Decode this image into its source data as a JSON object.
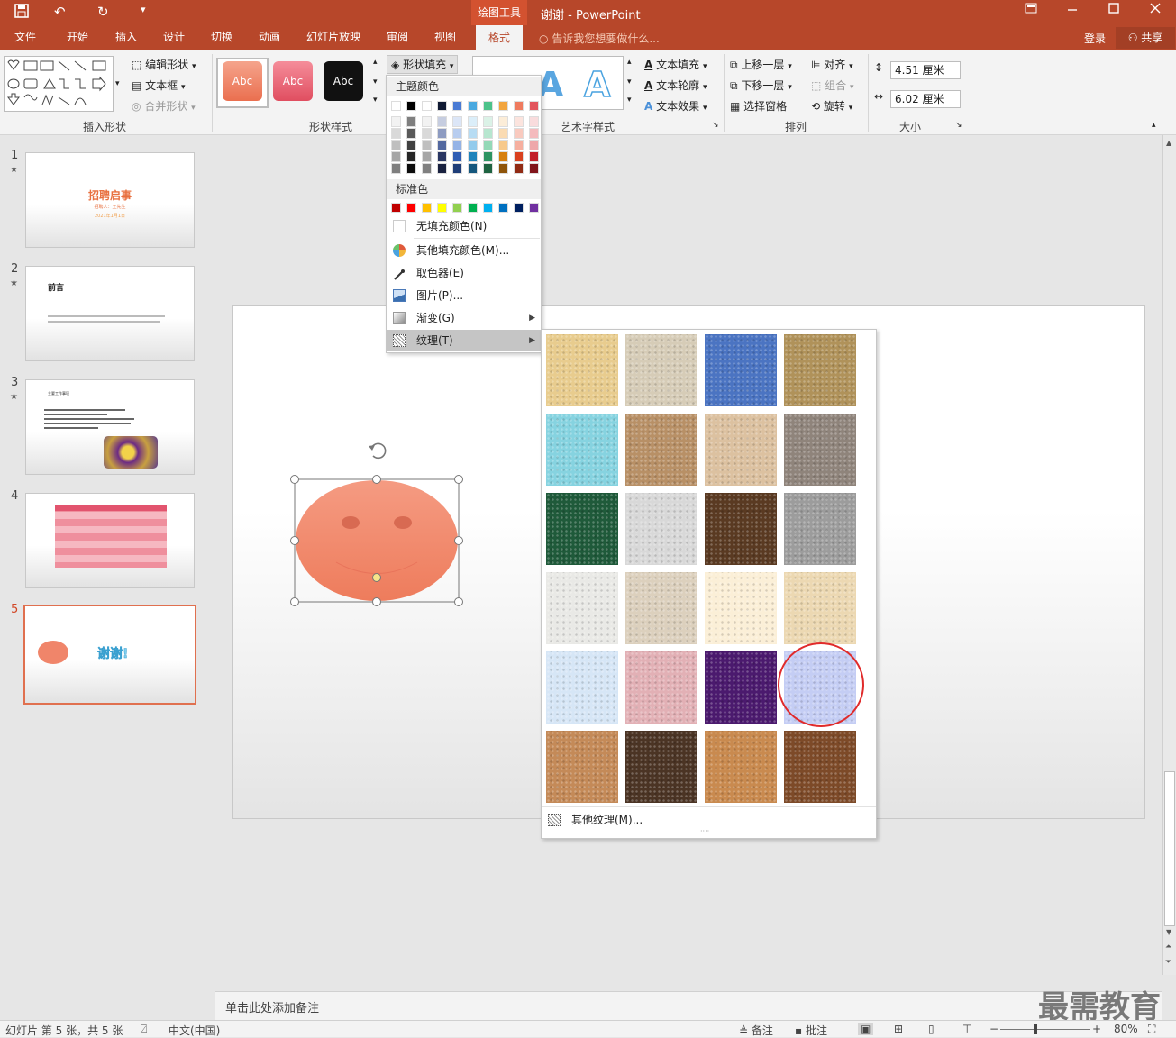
{
  "titlebar": {
    "tool_tab": "绘图工具",
    "title": "谢谢 - PowerPoint",
    "qat_undo": "↶",
    "qat_redo": "↻",
    "more": "▾"
  },
  "tabs": [
    "文件",
    "开始",
    "插入",
    "设计",
    "切换",
    "动画",
    "幻灯片放映",
    "审阅",
    "视图"
  ],
  "active_tab": "格式",
  "tell_me": "告诉我您想要做什么...",
  "login": "登录",
  "share": "共享",
  "ribbon": {
    "edit_shape": "编辑形状",
    "text_box": "文本框",
    "merge_shapes": "合并形状",
    "insert_shapes_label": "插入形状",
    "style_abc": [
      "Abc",
      "Abc",
      "Abc"
    ],
    "shape_styles_label": "形状样式",
    "shape_fill": "形状填充",
    "text_fill": "文本填充",
    "text_outline": "文本轮廓",
    "text_effects": "文本效果",
    "wordart_label": "艺术字样式",
    "bring_forward": "上移一层",
    "send_backward": "下移一层",
    "selection_pane": "选择窗格",
    "align": "对齐",
    "group": "组合",
    "rotate": "旋转",
    "arrange_label": "排列",
    "height": "4.51 厘米",
    "width": "6.02 厘米",
    "size_label": "大小"
  },
  "fill_menu": {
    "theme_colors_header": "主题颜色",
    "standard_colors_header": "标准色",
    "no_fill": "无填充颜色(N)",
    "more_fill": "其他填充颜色(M)...",
    "eyedropper": "取色器(E)",
    "picture": "图片(P)...",
    "gradient": "渐变(G)",
    "texture": "纹理(T)",
    "theme_top": [
      "#ffffff",
      "#000000",
      "#ffffff",
      "#101a33",
      "#4a7bd4",
      "#4aa9e0",
      "#4cc28a",
      "#f2a53f",
      "#ef7b5f",
      "#e2545c"
    ],
    "theme_cols": [
      [
        "#f2f2f2",
        "#d9d9d9",
        "#bfbfbf",
        "#a6a6a6",
        "#7f7f7f"
      ],
      [
        "#7f7f7f",
        "#595959",
        "#404040",
        "#262626",
        "#0d0d0d"
      ],
      [
        "#f2f2f2",
        "#d9d9d9",
        "#bfbfbf",
        "#a6a6a6",
        "#808080"
      ],
      [
        "#c6cde0",
        "#8d9bc1",
        "#53689f",
        "#2a3763",
        "#1a2240"
      ],
      [
        "#dce6f7",
        "#b8cdef",
        "#94b3e6",
        "#2f5db3",
        "#1f3e78"
      ],
      [
        "#dbeef9",
        "#b7dcf3",
        "#93cbec",
        "#1f83bb",
        "#15577d"
      ],
      [
        "#dbf2e7",
        "#b7e6cf",
        "#93d9b7",
        "#2d9462",
        "#1e6341"
      ],
      [
        "#fcedd8",
        "#fadbb2",
        "#f7c98b",
        "#d7800f",
        "#8f550a"
      ],
      [
        "#fce4de",
        "#f9cabf",
        "#f6af9f",
        "#d9411f",
        "#912b14"
      ],
      [
        "#f9dcdd",
        "#f4babd",
        "#eea8aa",
        "#c22029",
        "#81151b"
      ]
    ],
    "standard": [
      "#c00000",
      "#ff0000",
      "#ffc000",
      "#ffff00",
      "#92d050",
      "#00b050",
      "#00b0f0",
      "#0070c0",
      "#002060",
      "#7030a0"
    ]
  },
  "texture_menu": {
    "more_textures": "其他纹理(M)...",
    "textures": [
      "#e8cc8e",
      "#d6ccb7",
      "#4b74c2",
      "#b0925a",
      "#86d3e0",
      "#b89066",
      "#dcc1a0",
      "#8f847b",
      "#1f5a3a",
      "#d8d8d8",
      "#5a3a22",
      "#9c9c9c",
      "#e9e9e6",
      "#dcd0bd",
      "#fbefd7",
      "#ecd8b2",
      "#d6e6f6",
      "#e2b0b5",
      "#4b1a6e",
      "#c4cdf4",
      "#c48a58",
      "#4b3424",
      "#c98a4f",
      "#7d4a28"
    ]
  },
  "slides": [
    {
      "num": "1",
      "star": "★",
      "title": "招聘启事",
      "sub1": "招聘人：王先生",
      "sub2": "2021年1月1日"
    },
    {
      "num": "2",
      "star": "★",
      "title": "前言"
    },
    {
      "num": "3",
      "star": "★",
      "title": "主要工作事项"
    },
    {
      "num": "4",
      "star": ""
    },
    {
      "num": "5",
      "star": "",
      "text": "谢谢!"
    }
  ],
  "notes_placeholder": "单击此处添加备注",
  "status": {
    "slide_info": "幻灯片 第 5 张，共 5 张",
    "lang": "中文(中国)",
    "notes": "备注",
    "comments": "批注",
    "zoom": "80%"
  },
  "watermark": "最需教育",
  "colors": {
    "accent": "#b7472a",
    "face": "#f08a6e"
  }
}
